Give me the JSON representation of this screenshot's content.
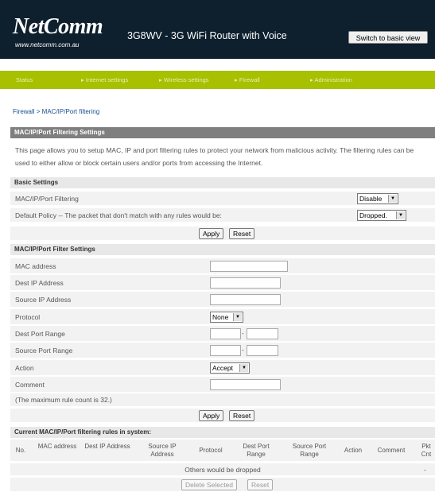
{
  "header": {
    "logo": "NetComm",
    "logo_url": "www.netcomm.com.au",
    "product": "3G8WV - 3G WiFi Router with Voice",
    "switch_button": "Switch to basic view"
  },
  "nav": [
    "Status",
    "Internet settings",
    "Wireless settings",
    "Firewall",
    "Administration"
  ],
  "breadcrumb": "Firewall > MAC/IP/Port filtering",
  "settings": {
    "title": "MAC/IP/Port Filtering Settings",
    "description_line1": "This page allows you to setup MAC, IP and port filtering rules to protect your network from malicious activity. The filtering rules can be",
    "description_line2": "used to either allow or block certain users and/or ports from accessing the Internet."
  },
  "basic": {
    "title": "Basic Settings",
    "filtering_label": "MAC/IP/Port Filtering",
    "filtering_value": "Disable",
    "policy_label": "Default Policy -- The packet that don't match with any rules would be:",
    "policy_value": "Dropped.",
    "apply": "Apply",
    "reset": "Reset"
  },
  "filter": {
    "title": "MAC/IP/Port Filter Settings",
    "mac_label": "MAC address",
    "dest_ip_label": "Dest IP Address",
    "source_ip_label": "Source IP Address",
    "protocol_label": "Protocol",
    "protocol_value": "None",
    "dest_port_label": "Dest Port Range",
    "source_port_label": "Source Port Range",
    "action_label": "Action",
    "action_value": "Accept",
    "comment_label": "Comment",
    "max_rule_note": "(The maximum rule count is 32.)",
    "apply": "Apply",
    "reset": "Reset"
  },
  "rules": {
    "title": "Current MAC/IP/Port filtering rules in system:",
    "columns": [
      "No.",
      "MAC address",
      "Dest IP Address",
      "Source IP Address",
      "Protocol",
      "Dest Port Range",
      "Source Port Range",
      "Action",
      "Comment",
      "Pkt Cnt"
    ],
    "others_text": "Others would be dropped",
    "others_pkt": "-",
    "delete_button": "Delete Selected",
    "reset_button": "Reset"
  }
}
